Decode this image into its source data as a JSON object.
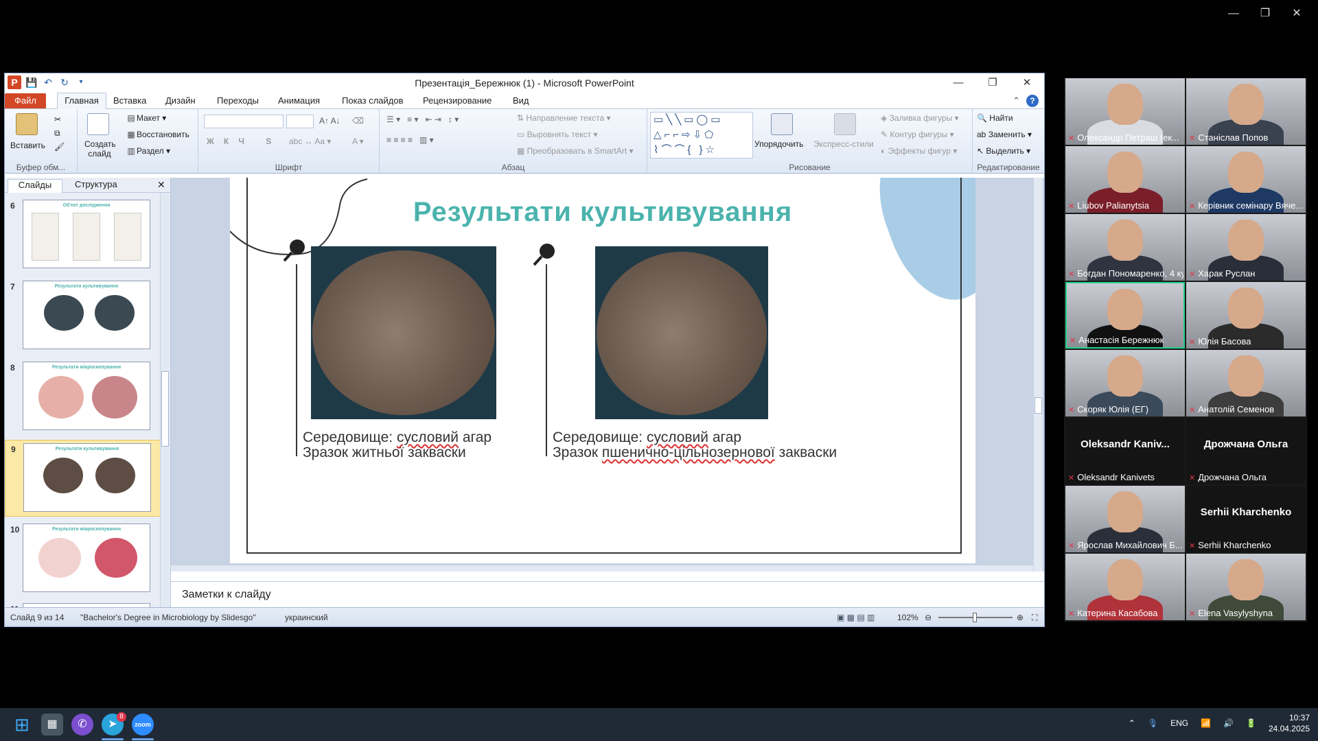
{
  "window": {
    "title": "Презентація_Бережнюк (1) - Microsoft PowerPoint",
    "min": "—",
    "restore": "❐",
    "close": "✕"
  },
  "tabs": {
    "file": "Файл",
    "home": "Главная",
    "insert": "Вставка",
    "design": "Дизайн",
    "transitions": "Переходы",
    "animation": "Анимация",
    "slideshow": "Показ слайдов",
    "review": "Рецензирование",
    "view": "Вид"
  },
  "ribbon": {
    "paste": "Вставить",
    "clipboard": "Буфер обм...",
    "new_slide": "Создать слайд",
    "layout": "Макет",
    "reset": "Восстановить",
    "section": "Раздел",
    "font_group": "Шрифт",
    "paragraph_group": "Абзац",
    "text_direction": "Направление текста",
    "align_text": "Выровнять текст",
    "smartart": "Преобразовать в SmartArt",
    "arrange": "Упорядочить",
    "quick_styles": "Экспресс-стили",
    "shape_fill": "Заливка фигуры",
    "shape_outline": "Контур фигуры",
    "shape_effects": "Эффекты фигур",
    "drawing_group": "Рисование",
    "find": "Найти",
    "replace": "Заменить",
    "select": "Выделить",
    "editing_group": "Редактирование"
  },
  "panel": {
    "tab_slides": "Слайды",
    "tab_outline": "Структура",
    "thumbs": [
      {
        "num": "6",
        "title": "Об'єкт дослідження"
      },
      {
        "num": "7",
        "title": "Результати культивування"
      },
      {
        "num": "8",
        "title": "Результати мікроскопування"
      },
      {
        "num": "9",
        "title": "Результати культивування"
      },
      {
        "num": "10",
        "title": "Результати мікроскопування"
      },
      {
        "num": "11",
        "title": ""
      }
    ]
  },
  "slide": {
    "title": "Результати культивування",
    "left_caption_1a": "Середовище:",
    "left_caption_1b": "сусловий",
    "left_caption_1c": "агар",
    "left_caption_2": "Зразок житньої закваски",
    "right_caption_1a": "Середовище:",
    "right_caption_1b": "сусловий",
    "right_caption_1c": "агар",
    "right_caption_2a": "Зразок",
    "right_caption_2b": "пшенично-цільнозернової",
    "right_caption_2c": "закваски"
  },
  "notes": {
    "placeholder": "Заметки к слайду"
  },
  "status": {
    "slide": "Слайд 9 из 14",
    "theme": "\"Bachelor's Degree in Microbiology by Slidesgo\"",
    "lang": "украинский",
    "zoom": "102%"
  },
  "participants": [
    {
      "name": "Олександр Петраш (ек...",
      "video": true,
      "shirt": "#d9dde3"
    },
    {
      "name": "Станіслав Попов",
      "video": true,
      "shirt": "#3a4250"
    },
    {
      "name": "Liubov Palianytsia",
      "video": true,
      "shirt": "#7a1f2a"
    },
    {
      "name": "Керівник семінару Вяче...",
      "video": true,
      "shirt": "#1e3a64"
    },
    {
      "name": "Богдан Пономаренко, 4 ку...",
      "video": true,
      "shirt": "#2f3440"
    },
    {
      "name": "Харак Руслан",
      "video": true,
      "shirt": "#2a2e38"
    },
    {
      "name": "Анастасія Бережнюк",
      "video": true,
      "shirt": "#111111",
      "active": true
    },
    {
      "name": "Юлія Басова",
      "video": true,
      "shirt": "#2b2b2b"
    },
    {
      "name": "Скоряк Юлія (ЕГ)",
      "video": true,
      "shirt": "#3b4a5a"
    },
    {
      "name": "Анатолій Семенов",
      "video": true,
      "shirt": "#3d3d3d"
    },
    {
      "name": "Oleksandr Kanivets",
      "video": false,
      "big": "Oleksandr Kaniv..."
    },
    {
      "name": "Дрожчана Ольга",
      "video": false,
      "big": "Дрожчана Ольга"
    },
    {
      "name": "Ярослав Михайлович Б...",
      "video": true,
      "shirt": "#2a2f3a"
    },
    {
      "name": "Serhii Kharchenko",
      "video": false,
      "big": "Serhii Kharchenko"
    },
    {
      "name": "Катерина Касабова",
      "video": true,
      "shirt": "#b0323a"
    },
    {
      "name": "Elena Vasylyshyna",
      "video": true,
      "shirt": "#3f4a3a"
    }
  ],
  "taskbar": {
    "lang": "ENG",
    "time": "10:37",
    "date": "24.04.2025",
    "telegram_badge": "8"
  }
}
